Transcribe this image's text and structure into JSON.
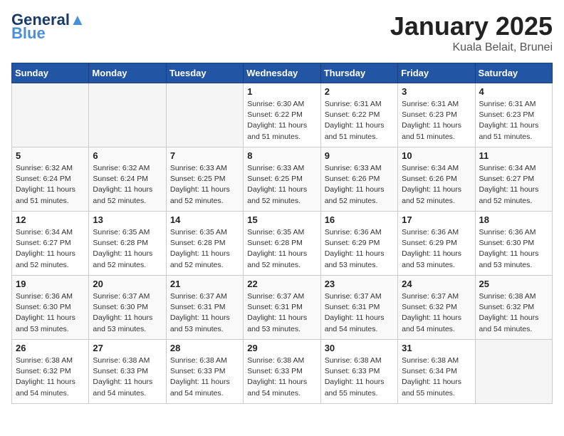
{
  "header": {
    "logo_line1": "General",
    "logo_line2": "Blue",
    "month": "January 2025",
    "location": "Kuala Belait, Brunei"
  },
  "weekdays": [
    "Sunday",
    "Monday",
    "Tuesday",
    "Wednesday",
    "Thursday",
    "Friday",
    "Saturday"
  ],
  "weeks": [
    [
      {
        "day": "",
        "info": ""
      },
      {
        "day": "",
        "info": ""
      },
      {
        "day": "",
        "info": ""
      },
      {
        "day": "1",
        "info": "Sunrise: 6:30 AM\nSunset: 6:22 PM\nDaylight: 11 hours\nand 51 minutes."
      },
      {
        "day": "2",
        "info": "Sunrise: 6:31 AM\nSunset: 6:22 PM\nDaylight: 11 hours\nand 51 minutes."
      },
      {
        "day": "3",
        "info": "Sunrise: 6:31 AM\nSunset: 6:23 PM\nDaylight: 11 hours\nand 51 minutes."
      },
      {
        "day": "4",
        "info": "Sunrise: 6:31 AM\nSunset: 6:23 PM\nDaylight: 11 hours\nand 51 minutes."
      }
    ],
    [
      {
        "day": "5",
        "info": "Sunrise: 6:32 AM\nSunset: 6:24 PM\nDaylight: 11 hours\nand 51 minutes."
      },
      {
        "day": "6",
        "info": "Sunrise: 6:32 AM\nSunset: 6:24 PM\nDaylight: 11 hours\nand 52 minutes."
      },
      {
        "day": "7",
        "info": "Sunrise: 6:33 AM\nSunset: 6:25 PM\nDaylight: 11 hours\nand 52 minutes."
      },
      {
        "day": "8",
        "info": "Sunrise: 6:33 AM\nSunset: 6:25 PM\nDaylight: 11 hours\nand 52 minutes."
      },
      {
        "day": "9",
        "info": "Sunrise: 6:33 AM\nSunset: 6:26 PM\nDaylight: 11 hours\nand 52 minutes."
      },
      {
        "day": "10",
        "info": "Sunrise: 6:34 AM\nSunset: 6:26 PM\nDaylight: 11 hours\nand 52 minutes."
      },
      {
        "day": "11",
        "info": "Sunrise: 6:34 AM\nSunset: 6:27 PM\nDaylight: 11 hours\nand 52 minutes."
      }
    ],
    [
      {
        "day": "12",
        "info": "Sunrise: 6:34 AM\nSunset: 6:27 PM\nDaylight: 11 hours\nand 52 minutes."
      },
      {
        "day": "13",
        "info": "Sunrise: 6:35 AM\nSunset: 6:28 PM\nDaylight: 11 hours\nand 52 minutes."
      },
      {
        "day": "14",
        "info": "Sunrise: 6:35 AM\nSunset: 6:28 PM\nDaylight: 11 hours\nand 52 minutes."
      },
      {
        "day": "15",
        "info": "Sunrise: 6:35 AM\nSunset: 6:28 PM\nDaylight: 11 hours\nand 52 minutes."
      },
      {
        "day": "16",
        "info": "Sunrise: 6:36 AM\nSunset: 6:29 PM\nDaylight: 11 hours\nand 53 minutes."
      },
      {
        "day": "17",
        "info": "Sunrise: 6:36 AM\nSunset: 6:29 PM\nDaylight: 11 hours\nand 53 minutes."
      },
      {
        "day": "18",
        "info": "Sunrise: 6:36 AM\nSunset: 6:30 PM\nDaylight: 11 hours\nand 53 minutes."
      }
    ],
    [
      {
        "day": "19",
        "info": "Sunrise: 6:36 AM\nSunset: 6:30 PM\nDaylight: 11 hours\nand 53 minutes."
      },
      {
        "day": "20",
        "info": "Sunrise: 6:37 AM\nSunset: 6:30 PM\nDaylight: 11 hours\nand 53 minutes."
      },
      {
        "day": "21",
        "info": "Sunrise: 6:37 AM\nSunset: 6:31 PM\nDaylight: 11 hours\nand 53 minutes."
      },
      {
        "day": "22",
        "info": "Sunrise: 6:37 AM\nSunset: 6:31 PM\nDaylight: 11 hours\nand 53 minutes."
      },
      {
        "day": "23",
        "info": "Sunrise: 6:37 AM\nSunset: 6:31 PM\nDaylight: 11 hours\nand 54 minutes."
      },
      {
        "day": "24",
        "info": "Sunrise: 6:37 AM\nSunset: 6:32 PM\nDaylight: 11 hours\nand 54 minutes."
      },
      {
        "day": "25",
        "info": "Sunrise: 6:38 AM\nSunset: 6:32 PM\nDaylight: 11 hours\nand 54 minutes."
      }
    ],
    [
      {
        "day": "26",
        "info": "Sunrise: 6:38 AM\nSunset: 6:32 PM\nDaylight: 11 hours\nand 54 minutes."
      },
      {
        "day": "27",
        "info": "Sunrise: 6:38 AM\nSunset: 6:33 PM\nDaylight: 11 hours\nand 54 minutes."
      },
      {
        "day": "28",
        "info": "Sunrise: 6:38 AM\nSunset: 6:33 PM\nDaylight: 11 hours\nand 54 minutes."
      },
      {
        "day": "29",
        "info": "Sunrise: 6:38 AM\nSunset: 6:33 PM\nDaylight: 11 hours\nand 54 minutes."
      },
      {
        "day": "30",
        "info": "Sunrise: 6:38 AM\nSunset: 6:33 PM\nDaylight: 11 hours\nand 55 minutes."
      },
      {
        "day": "31",
        "info": "Sunrise: 6:38 AM\nSunset: 6:34 PM\nDaylight: 11 hours\nand 55 minutes."
      },
      {
        "day": "",
        "info": ""
      }
    ]
  ]
}
